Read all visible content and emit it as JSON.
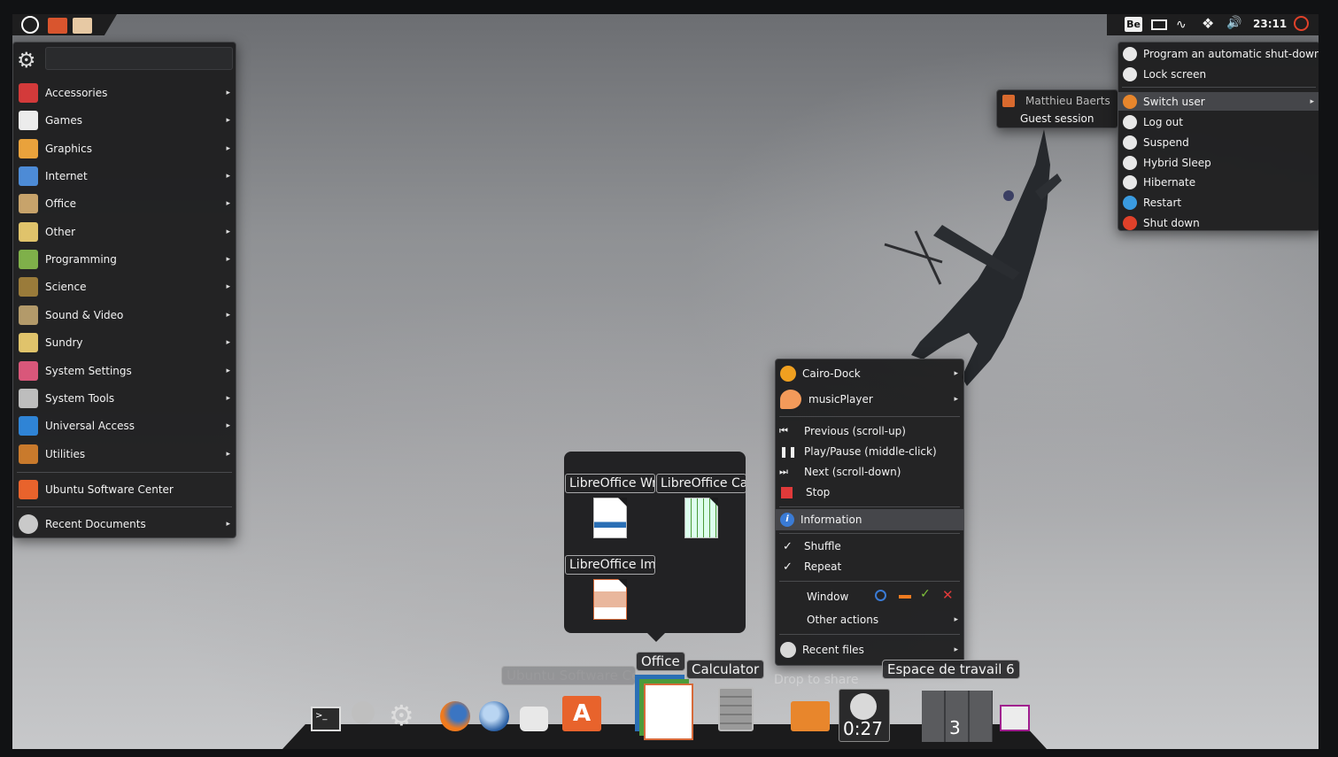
{
  "top_panel": {
    "keyboard_layout": "Be",
    "clock": "23:11",
    "icons": [
      "ubuntu-logo-icon",
      "files-icon",
      "folder-icon",
      "mail-icon",
      "wifi-icon",
      "dropbox-icon",
      "volume-icon",
      "power-icon"
    ]
  },
  "app_menu": {
    "search_placeholder": "",
    "categories": [
      {
        "label": "Accessories",
        "icon": "accessories-icon"
      },
      {
        "label": "Games",
        "icon": "games-icon"
      },
      {
        "label": "Graphics",
        "icon": "graphics-icon"
      },
      {
        "label": "Internet",
        "icon": "internet-icon"
      },
      {
        "label": "Office",
        "icon": "office-icon"
      },
      {
        "label": "Other",
        "icon": "other-icon"
      },
      {
        "label": "Programming",
        "icon": "programming-icon"
      },
      {
        "label": "Science",
        "icon": "science-icon"
      },
      {
        "label": "Sound & Video",
        "icon": "sound-video-icon"
      },
      {
        "label": "Sundry",
        "icon": "sundry-icon"
      },
      {
        "label": "System Settings",
        "icon": "system-settings-icon"
      },
      {
        "label": "System Tools",
        "icon": "system-tools-icon"
      },
      {
        "label": "Universal Access",
        "icon": "universal-access-icon"
      },
      {
        "label": "Utilities",
        "icon": "utilities-icon"
      }
    ],
    "software_center": "Ubuntu Software Center",
    "recent_documents": "Recent Documents"
  },
  "session_menu": {
    "items": [
      {
        "label": "Program an automatic shut-down"
      },
      {
        "label": "Lock screen"
      },
      {
        "label": "Switch user"
      },
      {
        "label": "Log out"
      },
      {
        "label": "Suspend"
      },
      {
        "label": "Hybrid Sleep"
      },
      {
        "label": "Hibernate"
      },
      {
        "label": "Restart"
      },
      {
        "label": "Shut down"
      }
    ]
  },
  "user_submenu": {
    "users": [
      "Matthieu Baerts",
      "Guest session"
    ]
  },
  "context_menu": {
    "items": {
      "cairo_dock": "Cairo-Dock",
      "music_player": "musicPlayer",
      "previous": "Previous (scroll-up)",
      "play_pause": "Play/Pause (middle-click)",
      "next": "Next (scroll-down)",
      "stop": "Stop",
      "information": "Information",
      "shuffle": "Shuffle",
      "repeat": "Repeat",
      "window": "Window",
      "other_actions": "Other actions",
      "recent_files": "Recent files"
    }
  },
  "office_stack": {
    "tiles": [
      "LibreOffice Writer",
      "LibreOffice Calc",
      "LibreOffice Impress"
    ]
  },
  "dock": {
    "labels": {
      "software_center": "Ubuntu Software Center",
      "office": "Office",
      "calculator": "Calculator",
      "drop_to_share": "Drop to share",
      "workspace": "Espace de travail 6"
    },
    "timer": "0:27",
    "workspace_count": "3"
  },
  "colors": {
    "panel": "#1e1e1f",
    "accent_orange": "#f0663a",
    "power_red": "#e0412a"
  }
}
